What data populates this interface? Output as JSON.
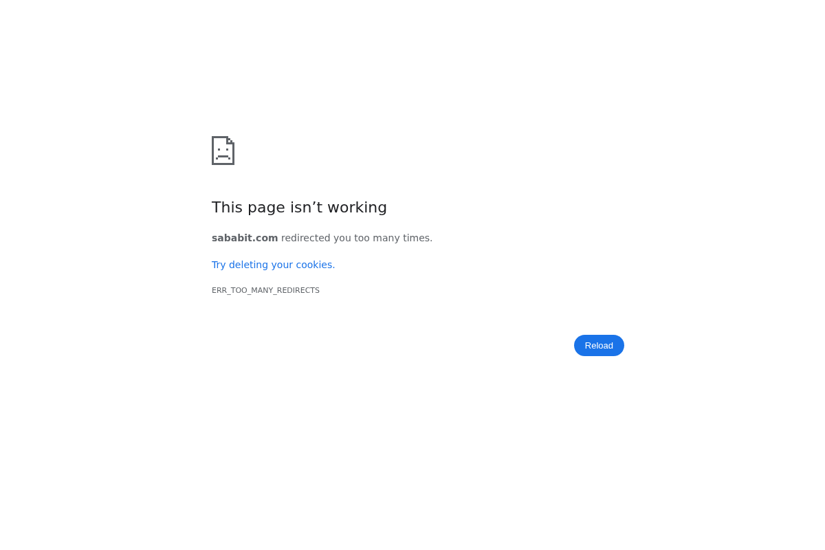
{
  "heading": "This page isn’t working",
  "message": "**sababit.com** redirected you too many times.",
  "suggestion_link": "Try deleting your cookies.",
  "error_code": "ERR_TOO_MANY_REDIRECTS",
  "reload_button": {
    "label": "Reload"
  }
}
